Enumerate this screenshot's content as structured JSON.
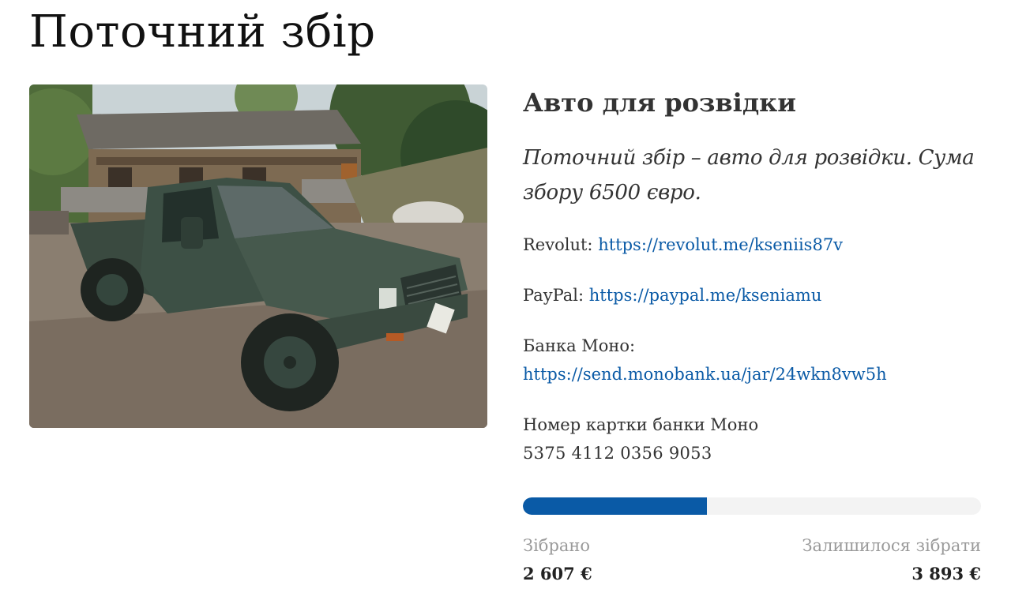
{
  "page": {
    "title": "Поточний збір"
  },
  "campaign": {
    "title": "Авто для розвідки",
    "description": "Поточний збір – авто для розвідки. Сума збору 6500 євро."
  },
  "payments": {
    "revolut_label": "Revolut:",
    "revolut_link": "https://revolut.me/kseniis87v",
    "paypal_label": "PayPal:",
    "paypal_link": "https://paypal.me/kseniamu",
    "mono_label": "Банка Моно:",
    "mono_link": "https://send.monobank.ua/jar/24wkn8vw5h",
    "card_label": "Номер картки банки Моно",
    "card_number": "5375 4112 0356 9053"
  },
  "progress": {
    "fraction": 0.401,
    "fill_color": "#0a5aa6",
    "track_color": "#f3f3f3",
    "collected_label": "Зібрано",
    "collected_value": "2 607 €",
    "remaining_label": "Залишилося зібрати",
    "remaining_value": "3 893 €"
  },
  "colors": {
    "link": "#0a5aa6",
    "text": "#333333",
    "muted": "#9a9a9a"
  }
}
